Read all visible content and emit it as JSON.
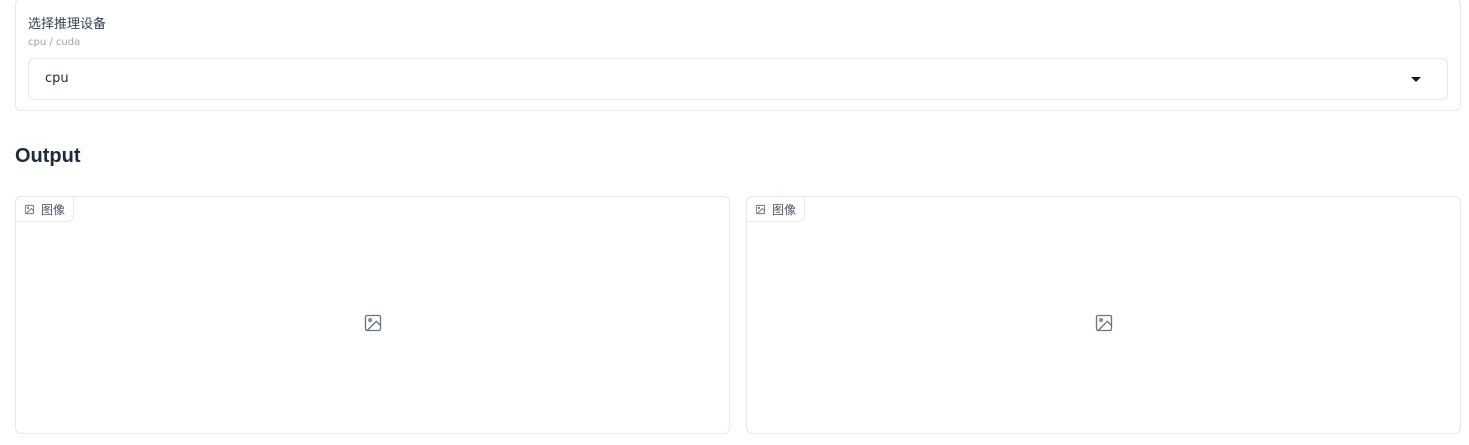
{
  "device": {
    "label": "选择推理设备",
    "info": "cpu / cuda",
    "selected_value": "cpu"
  },
  "output": {
    "heading": "Output",
    "panels": [
      {
        "tag": "图像",
        "tag_icon": "image-icon",
        "placeholder_icon": "image-placeholder-icon"
      },
      {
        "tag": "图像",
        "tag_icon": "image-icon",
        "placeholder_icon": "image-placeholder-icon"
      }
    ]
  },
  "colors": {
    "border": "#e5e7eb",
    "text": "#374151",
    "muted": "#9ca3af",
    "heading": "#1f2937"
  }
}
